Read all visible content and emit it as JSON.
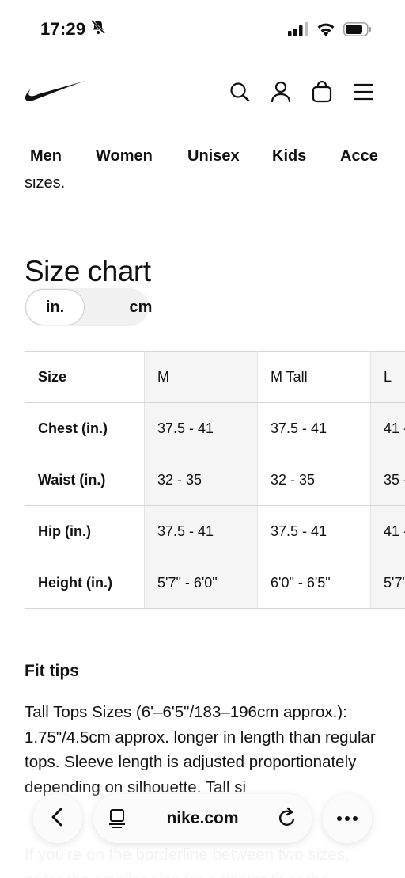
{
  "status_bar": {
    "time": "17:29",
    "icons": [
      "bell-slash-icon",
      "signal-icon",
      "wifi-icon",
      "battery-icon"
    ]
  },
  "header": {
    "logo": "nike-swoosh-logo",
    "icons": [
      "search-icon",
      "user-icon",
      "bag-icon",
      "menu-icon"
    ]
  },
  "nav": {
    "items": [
      "Men",
      "Women",
      "Unisex",
      "Kids",
      "Acce"
    ]
  },
  "partial_text": "sizes.",
  "size_chart": {
    "title": "Size chart",
    "units": {
      "active": "in.",
      "inactive": "cm"
    },
    "columns": [
      "Size",
      "M",
      "M Tall",
      "L"
    ],
    "rows": [
      {
        "label": "Chest (in.)",
        "m": "37.5 - 41",
        "m_tall": "37.5 - 41",
        "l": "41 -"
      },
      {
        "label": "Waist (in.)",
        "m": "32 - 35",
        "m_tall": "32 - 35",
        "l": "35 -"
      },
      {
        "label": "Hip (in.)",
        "m": "37.5 - 41",
        "m_tall": "37.5 - 41",
        "l": "41 -"
      },
      {
        "label": "Height (in.)",
        "m": "5'7\" - 6'0\"",
        "m_tall": "6'0\" - 6'5\"",
        "l": "5'7\""
      }
    ]
  },
  "fit_tips": {
    "title": "Fit tips",
    "paragraph1": "Tall Tops Sizes (6'–6'5\"/183–196cm approx.): 1.75\"/4.5cm approx. longer in length than regular tops. Sleeve length is adjusted proportionately depending on silhouette. Tall si",
    "paragraph2": "If you're on the borderline between two sizes, order the smaller size for a tighter fit or the"
  },
  "browser": {
    "url": "nike.com",
    "icons": [
      "back-icon",
      "tabs-icon",
      "reload-icon",
      "more-icon"
    ]
  }
}
